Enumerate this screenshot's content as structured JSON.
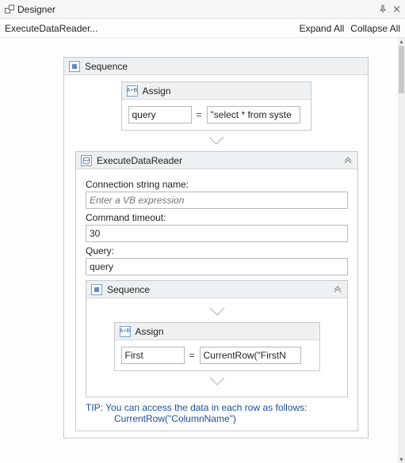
{
  "window": {
    "title": "Designer",
    "pin_icon": "pin",
    "close_icon": "close"
  },
  "breadcrumb": {
    "path": "ExecuteDataReader...",
    "expand_all": "Expand All",
    "collapse_all": "Collapse All"
  },
  "seq_outer": {
    "title": "Sequence"
  },
  "assign_outer": {
    "title": "Assign",
    "left": "query",
    "eq": "=",
    "right": "\"select * from syste"
  },
  "edr": {
    "title": "ExecuteDataReader",
    "conn_label": "Connection string name:",
    "conn_placeholder": "Enter a VB expression",
    "timeout_label": "Command timeout:",
    "timeout_value": "30",
    "query_label": "Query:",
    "query_value": "query"
  },
  "seq_inner": {
    "title": "Sequence"
  },
  "assign_inner": {
    "title": "Assign",
    "left": "First",
    "eq": "=",
    "right": "CurrentRow(\"FirstN"
  },
  "tip": {
    "line1": "TIP: You can access the data in each row as follows:",
    "line2": "CurrentRow(\"ColumnName\")"
  }
}
